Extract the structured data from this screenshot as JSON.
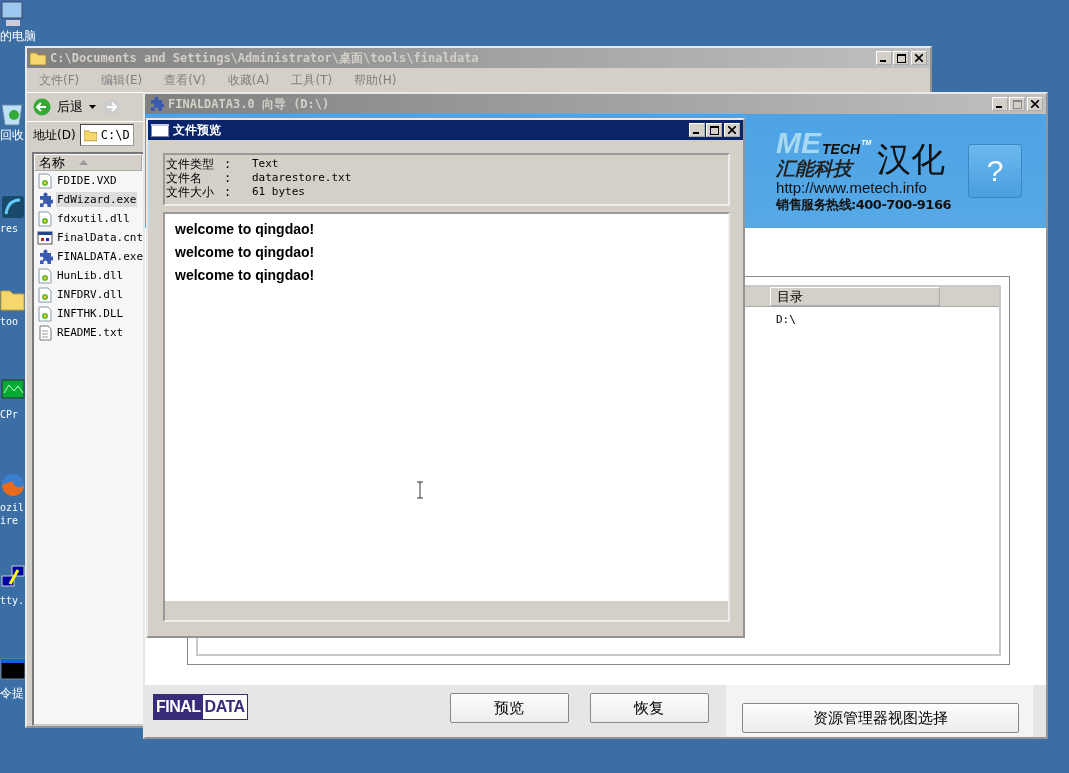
{
  "desktop_icons": [
    {
      "label": "的电脑",
      "kind": "computer"
    },
    {
      "label": "回收",
      "kind": "recycle"
    },
    {
      "label": "res",
      "kind": "app"
    },
    {
      "label": "too",
      "kind": "folder"
    },
    {
      "label": "CPr",
      "kind": "monitor"
    },
    {
      "label": "ozil\nire",
      "kind": "browser"
    },
    {
      "label": "tty.",
      "kind": "network"
    },
    {
      "label": "令提",
      "kind": "console"
    }
  ],
  "explorer_window": {
    "title": "C:\\Documents and Settings\\Administrator\\桌面\\tools\\finaldata",
    "menu": [
      "文件(F)",
      "编辑(E)",
      "查看(V)",
      "收藏(A)",
      "工具(T)",
      "帮助(H)"
    ],
    "back_label": "后退",
    "address": {
      "label": "地址(D)",
      "value": "C:\\D"
    },
    "column": "名称",
    "files": [
      {
        "name": "FDIDE.VXD",
        "kind": "file",
        "selected": false
      },
      {
        "name": "FdWizard.exe",
        "kind": "app",
        "selected": true
      },
      {
        "name": "fdxutil.dll",
        "kind": "file",
        "selected": false
      },
      {
        "name": "FinalData.cnt",
        "kind": "help",
        "selected": false
      },
      {
        "name": "FINALDATA.exe",
        "kind": "app",
        "selected": false
      },
      {
        "name": "HunLib.dll",
        "kind": "file",
        "selected": false
      },
      {
        "name": "INFDRV.dll",
        "kind": "file",
        "selected": false
      },
      {
        "name": "INFTHK.DLL",
        "kind": "file",
        "selected": false
      },
      {
        "name": "README.txt",
        "kind": "text",
        "selected": false
      }
    ]
  },
  "finaldata_window": {
    "title": "FINALDATA3.0 向导 (D:\\)",
    "banner": {
      "logo_me": "ME",
      "logo_tech": "TECH",
      "logo_tm": "TM",
      "company": "汇能科技",
      "hanhua": "汉化",
      "url": "http://www.metech.info",
      "hotline": "销售服务热线:400-700-9166",
      "help": "?"
    },
    "columns": [
      "目录"
    ],
    "rows": [
      [
        "D:\\"
      ]
    ],
    "footer_logo": [
      "FINAL",
      "DATA"
    ],
    "buttons": [
      "预览",
      "恢复"
    ],
    "explorer_button": "资源管理器视图选择"
  },
  "preview_dialog": {
    "title": "文件预览",
    "info": [
      {
        "label": "文件类型",
        "separator": ":",
        "value": "Text"
      },
      {
        "label": "文件名",
        "separator": ":",
        "value": "datarestore.txt"
      },
      {
        "label": "文件大小",
        "separator": ":",
        "value": "61 bytes"
      }
    ],
    "lines": [
      "welcome to qingdao!",
      "welcome to qingdao!",
      "welcome to qingdao!"
    ]
  }
}
